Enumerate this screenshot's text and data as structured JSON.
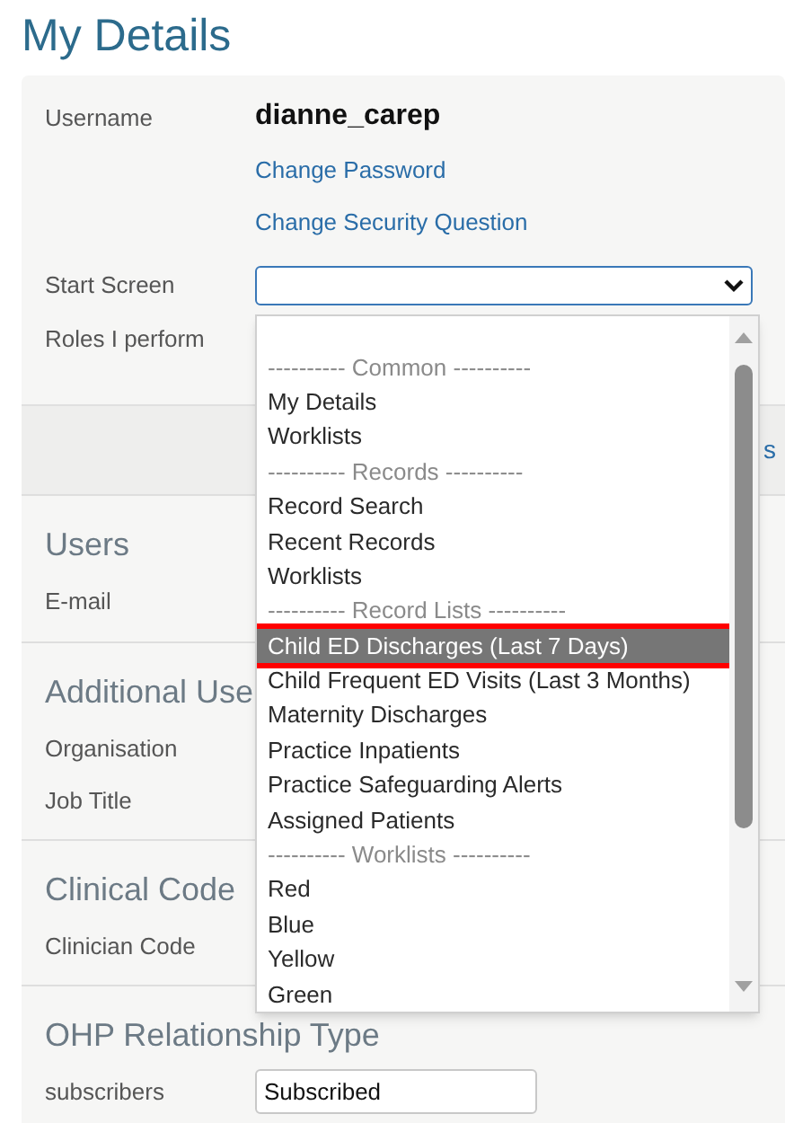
{
  "title": "My Details",
  "account": {
    "username_label": "Username",
    "username": "dianne_carep",
    "links": [
      "Change Password",
      "Change Security Question"
    ],
    "start_screen_label": "Start Screen",
    "roles_label": "Roles I perform",
    "band_link": "s"
  },
  "start_screen_dropdown": {
    "expanded": true,
    "red_outline": true,
    "options": [
      {
        "kind": "blank",
        "selected": false
      },
      {
        "kind": "header",
        "label": "---------- Common ----------",
        "selected": false
      },
      {
        "kind": "option",
        "label": "My Details",
        "selected": false
      },
      {
        "kind": "option",
        "label": "Worklists",
        "selected": false
      },
      {
        "kind": "header",
        "label": "---------- Records ----------",
        "selected": false
      },
      {
        "kind": "option",
        "label": "Record Search",
        "selected": false
      },
      {
        "kind": "option",
        "label": "Recent Records",
        "selected": false
      },
      {
        "kind": "option",
        "label": "Worklists",
        "selected": false
      },
      {
        "kind": "header",
        "label": "---------- Record Lists ----------",
        "selected": false
      },
      {
        "kind": "option",
        "label": "Child ED Discharges (Last 7 Days)",
        "selected": true
      },
      {
        "kind": "option",
        "label": "Child Frequent ED Visits (Last 3 Months)",
        "selected": false
      },
      {
        "kind": "option",
        "label": "Maternity Discharges",
        "selected": false
      },
      {
        "kind": "option",
        "label": "Practice Inpatients",
        "selected": false
      },
      {
        "kind": "option",
        "label": "Practice Safeguarding Alerts",
        "selected": false
      },
      {
        "kind": "option",
        "label": "Assigned Patients",
        "selected": false
      },
      {
        "kind": "header",
        "label": "---------- Worklists ----------",
        "selected": false
      },
      {
        "kind": "option",
        "label": "Red",
        "selected": false
      },
      {
        "kind": "option",
        "label": "Blue",
        "selected": false
      },
      {
        "kind": "option",
        "label": "Yellow",
        "selected": false
      },
      {
        "kind": "option",
        "label": "Green",
        "selected": false
      }
    ]
  },
  "sections": [
    {
      "heading": "Users",
      "fields": [
        "E-mail"
      ]
    },
    {
      "heading": "Additional Use",
      "fields": [
        "Organisation",
        "Job Title"
      ]
    },
    {
      "heading": "Clinical Code",
      "fields": [
        "Clinician Code"
      ]
    },
    {
      "heading": "OHP Relationship Type",
      "fields": [
        "subscribers"
      ],
      "input_value": "Subscribed"
    }
  ]
}
